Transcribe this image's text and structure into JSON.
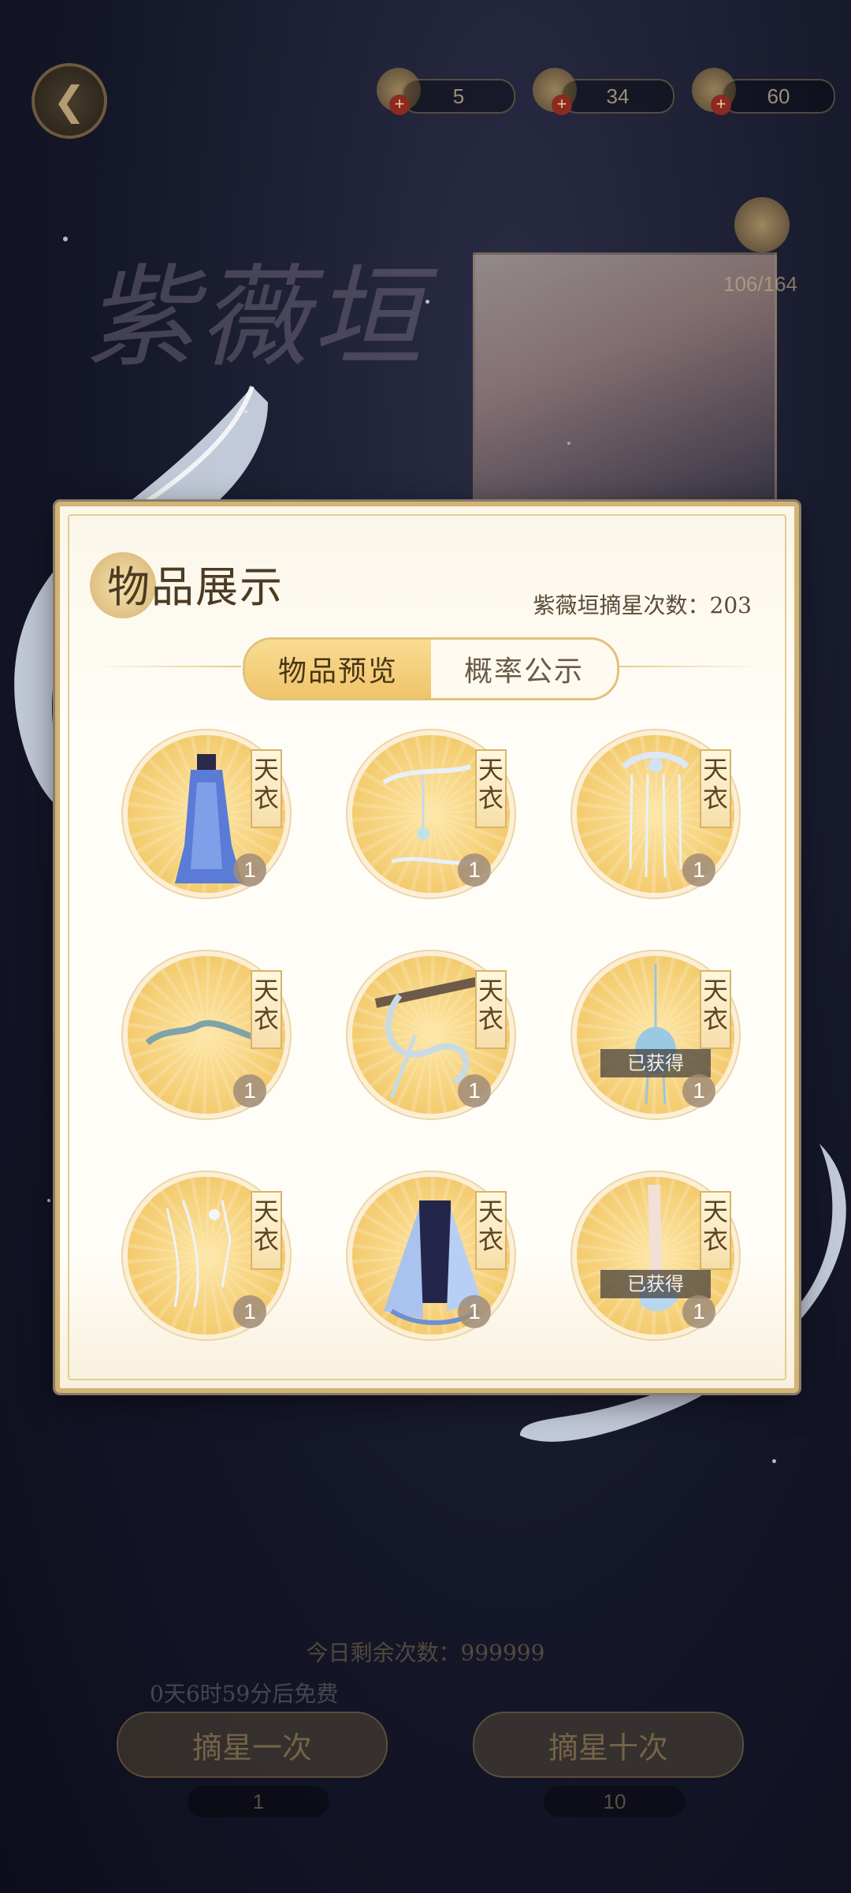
{
  "topbar": {
    "back_icon": "back-arrow-icon",
    "currencies": [
      {
        "name": "ticket",
        "value": "5"
      },
      {
        "name": "coin",
        "value": "34"
      },
      {
        "name": "pearl",
        "value": "60"
      }
    ]
  },
  "background": {
    "pool_title": "紫薇垣",
    "progress": "106/164",
    "remaining_today": "今日剩余次数：999999",
    "free_timer": "0天6时59分后免费",
    "draw_once": "摘星一次",
    "draw_ten": "摘星十次",
    "cost_once": "1",
    "cost_ten": "10"
  },
  "modal": {
    "title": "物品展示",
    "draw_count_label": "紫薇垣摘星次数：203",
    "tabs": [
      {
        "label": "物品预览",
        "active": true
      },
      {
        "label": "概率公示",
        "active": false
      }
    ],
    "items": [
      {
        "tag": "天衣",
        "qty": "1",
        "obtained": "",
        "art": "blue-gown"
      },
      {
        "tag": "天衣",
        "qty": "1",
        "obtained": "",
        "art": "ribbon-hairpin"
      },
      {
        "tag": "天衣",
        "qty": "1",
        "obtained": "",
        "art": "tassel-headpiece"
      },
      {
        "tag": "天衣",
        "qty": "1",
        "obtained": "",
        "art": "cloud-ornament"
      },
      {
        "tag": "天衣",
        "qty": "1",
        "obtained": "",
        "art": "branch-ornament"
      },
      {
        "tag": "天衣",
        "qty": "1",
        "obtained": "已获得",
        "art": "pendant"
      },
      {
        "tag": "天衣",
        "qty": "1",
        "obtained": "",
        "art": "hair-strands"
      },
      {
        "tag": "天衣",
        "qty": "1",
        "obtained": "",
        "art": "blue-robe"
      },
      {
        "tag": "天衣",
        "qty": "1",
        "obtained": "已获得",
        "art": "glass-shoes"
      }
    ]
  },
  "colors": {
    "accent_gold": "#d2b473",
    "tab_active": "#f0c46a",
    "modal_bg": "#fffdf7"
  }
}
